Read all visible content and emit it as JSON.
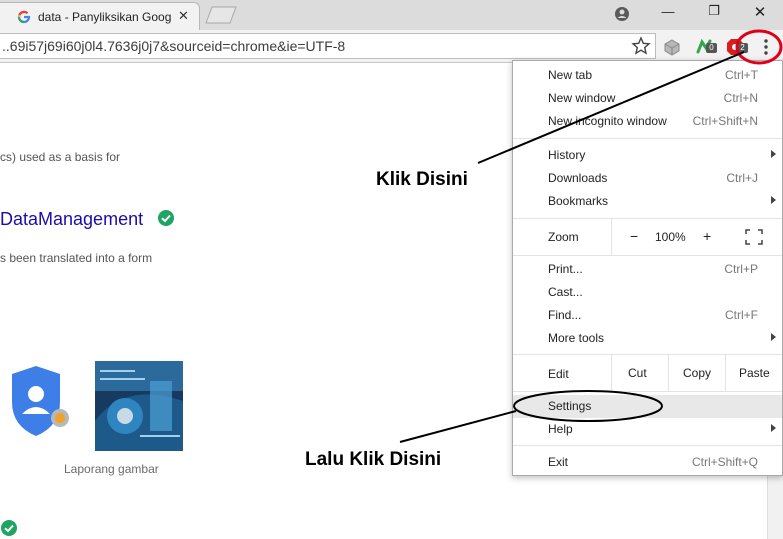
{
  "browser": {
    "tab_title": "data - Panyliksikan Googl",
    "tab_close": "✕",
    "url": "..69i57j69i60j0l4.7636j0j7&sourceid=chrome&ie=UTF-8",
    "window_controls": {
      "minimize": "—",
      "maximize": "❐",
      "close": "✕"
    },
    "ext_badges": [
      "0",
      "2"
    ],
    "colors": {
      "tabstrip": "#dcdcdc",
      "toolbar": "#f2f2f2",
      "link": "#1a0dab",
      "check": "#1fa463"
    }
  },
  "page": {
    "snippet1": "cs) used as a basis for",
    "result_link": "DataManagement",
    "snippet2": "s been translated into a form",
    "image_label": "Laporang gambar"
  },
  "menu": {
    "new_tab": {
      "label": "New tab",
      "shortcut": "Ctrl+T"
    },
    "new_window": {
      "label": "New window",
      "shortcut": "Ctrl+N"
    },
    "new_incognito": {
      "label": "New incognito window",
      "shortcut": "Ctrl+Shift+N"
    },
    "history": {
      "label": "History"
    },
    "downloads": {
      "label": "Downloads",
      "shortcut": "Ctrl+J"
    },
    "bookmarks": {
      "label": "Bookmarks"
    },
    "zoom": {
      "label": "Zoom",
      "minus": "−",
      "value": "100%",
      "plus": "+"
    },
    "print": {
      "label": "Print...",
      "shortcut": "Ctrl+P"
    },
    "cast": {
      "label": "Cast..."
    },
    "find": {
      "label": "Find...",
      "shortcut": "Ctrl+F"
    },
    "more_tools": {
      "label": "More tools"
    },
    "edit": {
      "label": "Edit",
      "cut": "Cut",
      "copy": "Copy",
      "paste": "Paste"
    },
    "settings": {
      "label": "Settings"
    },
    "help": {
      "label": "Help"
    },
    "exit": {
      "label": "Exit",
      "shortcut": "Ctrl+Shift+Q"
    }
  },
  "annotations": {
    "klik_disini": "Klik Disini",
    "lalu_klik_disini": "Lalu Klik Disini",
    "color": "#e0001b"
  }
}
